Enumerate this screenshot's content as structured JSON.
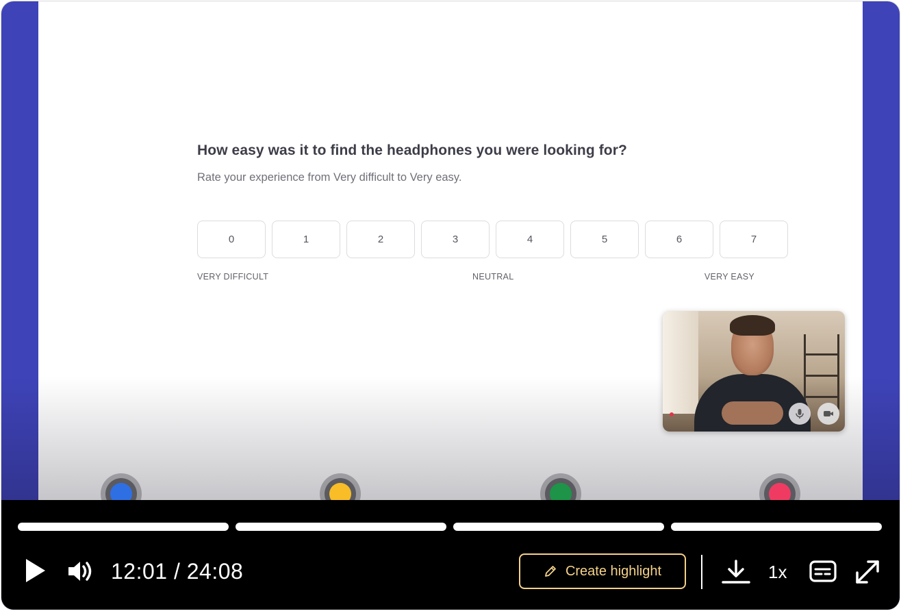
{
  "survey": {
    "question": "How easy was it to find the headphones you were looking for?",
    "subtitle": "Rate your experience from Very difficult to Very easy.",
    "scale": [
      "0",
      "1",
      "2",
      "3",
      "4",
      "5",
      "6",
      "7"
    ],
    "label_low": "VERY DIFFICULT",
    "label_mid": "NEUTRAL",
    "label_high": "VERY EASY"
  },
  "webcam": {
    "mic_icon": "microphone-icon",
    "camera_icon": "video-camera-icon"
  },
  "markers": [
    {
      "color": "#2f6fe4"
    },
    {
      "color": "#f8bd27"
    },
    {
      "color": "#1d9448"
    },
    {
      "color": "#ef3b62"
    }
  ],
  "player": {
    "current_time": "12:01",
    "duration": "24:08",
    "time_display": "12:01 / 24:08",
    "highlight_label": "Create highlight",
    "speed": "1x",
    "icons": {
      "play": "play-icon",
      "volume": "volume-icon",
      "highlight": "pencil-icon",
      "download": "download-icon",
      "captions": "captions-icon",
      "fullscreen": "fullscreen-icon"
    }
  },
  "colors": {
    "frame": "#3e43b8",
    "highlight_accent": "#f5d28a",
    "controls_bg": "#000000"
  }
}
